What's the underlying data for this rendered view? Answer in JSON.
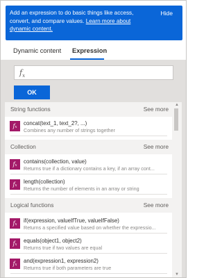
{
  "banner": {
    "text": "Add an expression to do basic things like access, convert, and compare values.",
    "link": "Learn more about dynamic content.",
    "hide": "Hide"
  },
  "tabs": [
    {
      "label": "Dynamic content",
      "active": false
    },
    {
      "label": "Expression",
      "active": true
    }
  ],
  "input": {
    "glyph": "f",
    "sub": "x",
    "value": ""
  },
  "ok_label": "OK",
  "sections": [
    {
      "title": "String functions",
      "see_more": "See more",
      "items": [
        {
          "name": "concat(text_1, text_2?, ...)",
          "desc": "Combines any number of strings together"
        }
      ]
    },
    {
      "title": "Collection",
      "see_more": "See more",
      "items": [
        {
          "name": "contains(collection, value)",
          "desc": "Returns true if a dictionary contains a key, if an array cont..."
        },
        {
          "name": "length(collection)",
          "desc": "Returns the number of elements in an array or string"
        }
      ]
    },
    {
      "title": "Logical functions",
      "see_more": "See more",
      "items": [
        {
          "name": "if(expression, valueIfTrue, valueIfFalse)",
          "desc": "Returns a specified value based on whether the expressio..."
        },
        {
          "name": "equals(object1, object2)",
          "desc": "Returns true if two values are equal"
        },
        {
          "name": "and(expression1, expression2)",
          "desc": "Returns true if both parameters are true"
        }
      ]
    }
  ],
  "colors": {
    "accent": "#0a66d8",
    "function_icon": "#a31968",
    "section_bg": "#f3f2f1",
    "outer_bg": "#e1dfdd"
  },
  "icons": {
    "function": "fx-icon",
    "scroll_up": "chevron-up-icon",
    "scroll_down": "chevron-down-icon"
  }
}
